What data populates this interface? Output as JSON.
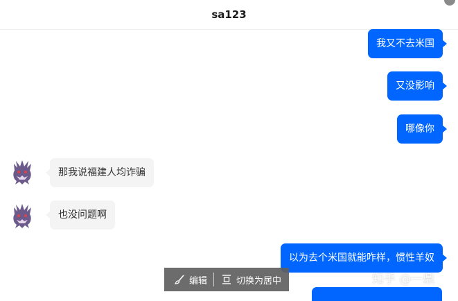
{
  "header": {
    "title": "sa123"
  },
  "messages": [
    {
      "side": "out",
      "text": "我又不去米国"
    },
    {
      "side": "out",
      "text": "又没影响"
    },
    {
      "side": "out",
      "text": "哪像你"
    },
    {
      "side": "in",
      "text": "那我说福建人均诈骗"
    },
    {
      "side": "in",
      "text": "也没问题啊"
    },
    {
      "side": "out",
      "text": "以为去个米国就能咋样，惯性羊奴"
    }
  ],
  "toolbar": {
    "edit_label": "编辑",
    "center_label": "切换为居中"
  },
  "watermark": "知乎 @一鼎",
  "colors": {
    "outgoing_bubble": "#0066ff",
    "incoming_bubble": "#f4f4f4",
    "toolbar_bg": "#606060"
  },
  "icons": {
    "avatar": "purple-ghost-avatar",
    "edit": "brush-icon",
    "center": "align-center-icon"
  }
}
